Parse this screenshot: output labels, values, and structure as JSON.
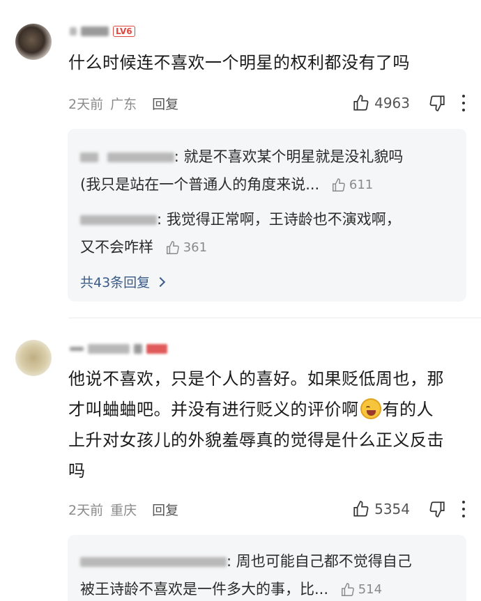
{
  "comments": [
    {
      "level_badge": "LV6",
      "text": "什么时候连不喜欢一个明星的权利都没有了吗",
      "time": "2天前",
      "location": "广东",
      "reply_label": "回复",
      "likes": "4963",
      "replies": [
        {
          "text": ": 就是不喜欢某个明星就是没礼貌吗",
          "text2": "(我只是站在一个普通人的角度来说...",
          "likes": "611"
        },
        {
          "text": ": 我觉得正常啊，王诗龄也不演戏啊，",
          "text2": "又不会咋样",
          "likes": "361"
        }
      ],
      "more_replies": "共43条回复"
    },
    {
      "text_lines": [
        "他说不喜欢，只是个人的喜好。如果贬低周也，那",
        "才叫蛐蛐吧。并没有进行贬义的评价啊",
        "有的人",
        "上升对女孩儿的外貌羞辱真的觉得是什么正义反击",
        "吗"
      ],
      "time": "2天前",
      "location": "重庆",
      "reply_label": "回复",
      "likes": "5354",
      "replies": [
        {
          "text": ": 周也可能自己都不觉得自己",
          "text2": "被王诗龄不喜欢是一件多大的事，",
          "text2_tail": "比...",
          "likes": "514"
        }
      ]
    }
  ],
  "icons": [
    "thumbs-up-icon",
    "thumbs-down-icon",
    "more-vertical-icon",
    "laughing-emoji-icon",
    "chevron-right-icon"
  ]
}
